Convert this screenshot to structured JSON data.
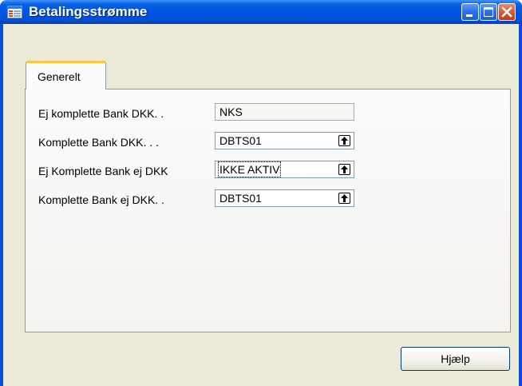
{
  "window": {
    "title": "Betalingsstrømme",
    "icon": "form-icon"
  },
  "titlebar_buttons": {
    "minimize_icon": "minimize-icon",
    "maximize_icon": "maximize-icon",
    "close_icon": "close-icon"
  },
  "tabs": [
    {
      "label": "Generelt",
      "selected": true
    }
  ],
  "fields": [
    {
      "label": "Ej komplette Bank DKK. .",
      "value": "NKS",
      "lookup": false
    },
    {
      "label": "Komplette Bank DKK. . .",
      "value": "DBTS01",
      "lookup": true
    },
    {
      "label": "Ej Komplette Bank ej DKK",
      "value": "IKKE AKTIV",
      "lookup": true,
      "focused": true
    },
    {
      "label": "Komplette Bank ej DKK. .",
      "value": "DBTS01",
      "lookup": true
    }
  ],
  "buttons": {
    "help": "Hjælp"
  },
  "colors": {
    "titlebar": "#0054e3",
    "tab_accent": "#ffc83c",
    "dialog_bg": "#ece9d8",
    "close_button": "#d95c35"
  }
}
